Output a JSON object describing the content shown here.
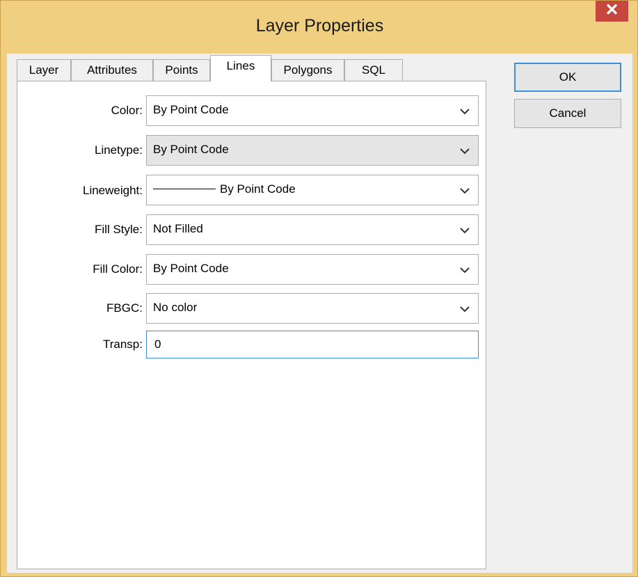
{
  "window": {
    "title": "Layer Properties",
    "close_glyph": "✕"
  },
  "tabs": [
    {
      "label": "Layer"
    },
    {
      "label": "Attributes"
    },
    {
      "label": "Points"
    },
    {
      "label": "Lines",
      "active": true
    },
    {
      "label": "Polygons"
    },
    {
      "label": "SQL"
    }
  ],
  "fields": {
    "color": {
      "label": "Color:",
      "value": "By Point Code"
    },
    "linetype": {
      "label": "Linetype:",
      "value": "By Point Code"
    },
    "lineweight": {
      "label": "Lineweight:",
      "value": "By Point Code"
    },
    "fill_style": {
      "label": "Fill Style:",
      "value": "Not Filled"
    },
    "fill_color": {
      "label": "Fill Color:",
      "value": "By Point Code"
    },
    "fbgc": {
      "label": "FBGC:",
      "value": "No color"
    },
    "transp": {
      "label": "Transp:",
      "value": "0"
    }
  },
  "buttons": {
    "ok": "OK",
    "cancel": "Cancel"
  },
  "icons": {
    "close": "close-icon",
    "dropdown": "chevron-down-icon"
  },
  "colors": {
    "title_bar": "#f1cf80",
    "close_button": "#c7463e",
    "focus_border": "#3c8fd8"
  }
}
